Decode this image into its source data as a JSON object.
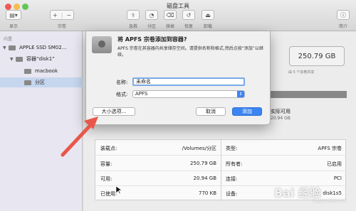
{
  "window": {
    "title": "磁盘工具"
  },
  "toolbar": {
    "display_label": "显示",
    "volume_label": "宗卷",
    "firstaid_label": "急救",
    "partition_label": "分区",
    "erase_label": "抹掉",
    "restore_label": "恢复",
    "unmount_label": "卸载",
    "info_label": "简介"
  },
  "sidebar": {
    "header": "内置",
    "items": [
      {
        "label": "APPLE SSD SM02..."
      },
      {
        "label": "容器“disk1”"
      },
      {
        "label": "macbook"
      },
      {
        "label": "分区"
      }
    ]
  },
  "main": {
    "capacity": "250.79 GB",
    "capacity_sub": "由 5 个宗卷共享",
    "available_label": "实际可用",
    "available_value": "20.94 GB"
  },
  "info": {
    "left": [
      {
        "label": "装载点:",
        "value": "/Volumes/分区"
      },
      {
        "label": "容量:",
        "value": "250.79 GB"
      },
      {
        "label": "可用:",
        "value": "20.94 GB"
      },
      {
        "label": "已使用:",
        "value": "770 KB"
      }
    ],
    "right": [
      {
        "label": "类型:",
        "value": "APFS 宗卷"
      },
      {
        "label": "所有者:",
        "value": "已启用"
      },
      {
        "label": "连接:",
        "value": "PCI"
      },
      {
        "label": "设备:",
        "value": "disk1s5"
      }
    ]
  },
  "dialog": {
    "title": "将 APFS 宗卷添加到容器?",
    "description": "APFS 宗卷在其容器内共享储存空间。请提供名称和格式,然后点按“添加”以继续。",
    "name_label": "名称:",
    "name_value": "未命名",
    "format_label": "格式:",
    "format_value": "APFS",
    "size_options_button": "大小选项...",
    "cancel_button": "取消",
    "add_button": "添加"
  },
  "watermark": {
    "main": "Bai 经验",
    "sub": "jingyan.baidu.com"
  },
  "colors": {
    "accent": "#3b84f2",
    "arrow": "#e8574a",
    "selection": "#c6d6ef"
  }
}
